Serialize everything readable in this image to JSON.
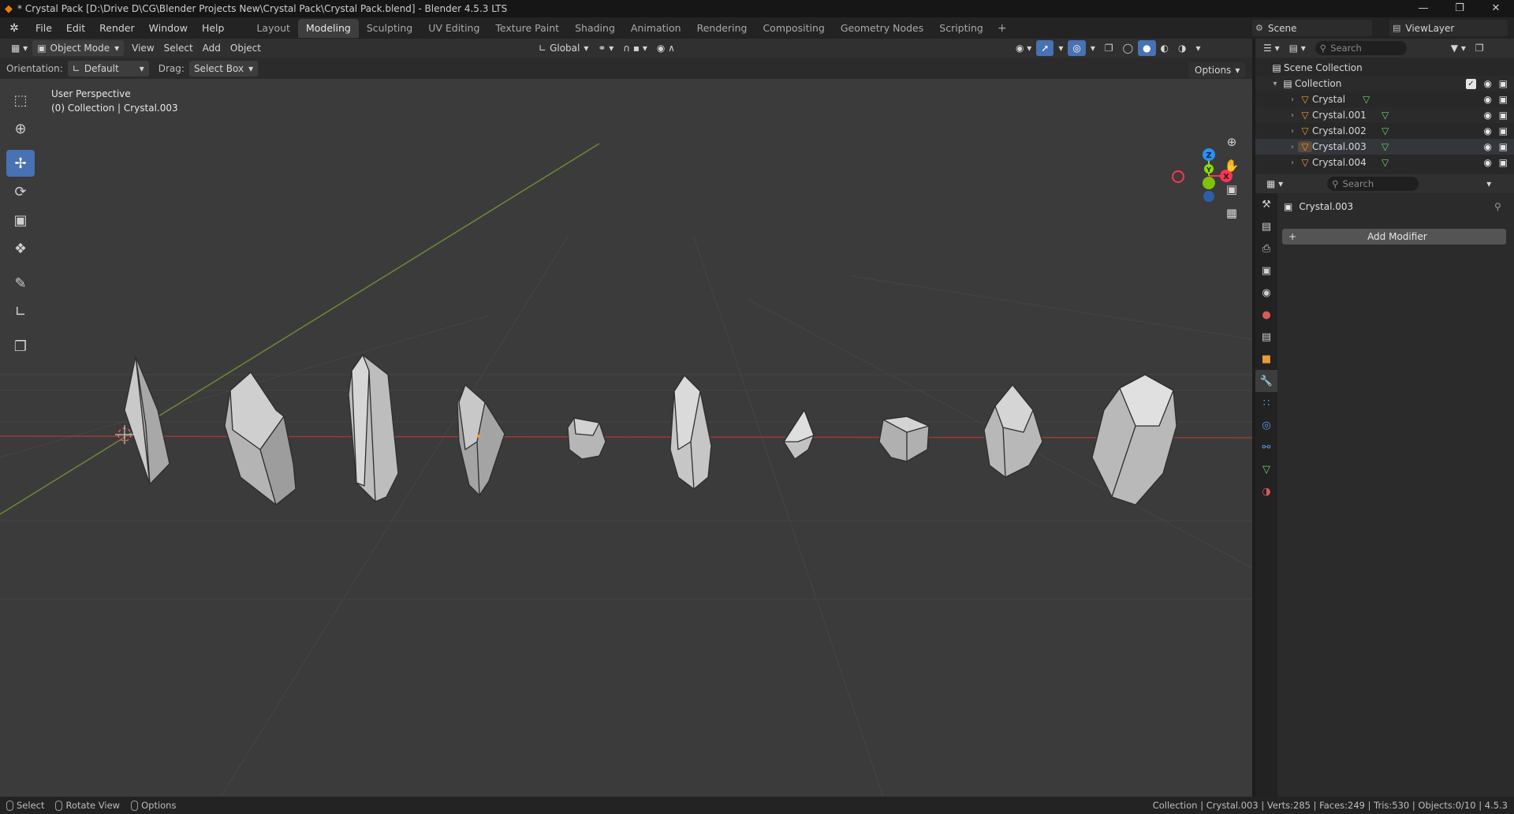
{
  "window": {
    "title": "* Crystal Pack [D:\\Drive D\\CG\\Blender Projects New\\Crystal Pack\\Crystal Pack.blend] - Blender 4.5.3 LTS",
    "controls": [
      "—",
      "❐",
      "✕"
    ]
  },
  "menu": {
    "items": [
      "File",
      "Edit",
      "Render",
      "Window",
      "Help"
    ]
  },
  "workspaces": {
    "tabs": [
      "Layout",
      "Modeling",
      "Sculpting",
      "UV Editing",
      "Texture Paint",
      "Shading",
      "Animation",
      "Rendering",
      "Compositing",
      "Geometry Nodes",
      "Scripting"
    ],
    "active": "Modeling",
    "add": "+"
  },
  "scene": {
    "label": "Scene"
  },
  "view_layer": {
    "label": "ViewLayer"
  },
  "viewport_header": {
    "mode": "Object Mode",
    "menus": [
      "View",
      "Select",
      "Add",
      "Object"
    ],
    "transform_orientation": "Global",
    "orientation_label": "Orientation:",
    "orientation_value": "Default",
    "drag_label": "Drag:",
    "drag_value": "Select Box",
    "options": "Options"
  },
  "viewport": {
    "perspective": "User Perspective",
    "collection_info": "(0) Collection | Crystal.003",
    "gizmo_axes": [
      "X",
      "Y",
      "Z"
    ]
  },
  "toolbar": {
    "tools": [
      "select-box",
      "cursor",
      "move",
      "rotate",
      "scale",
      "transform",
      "annotate",
      "measure",
      "add-cube"
    ],
    "active": "move"
  },
  "outliner": {
    "search_placeholder": "Search",
    "scene_collection": "Scene Collection",
    "collection": "Collection",
    "objects": [
      "Crystal",
      "Crystal.001",
      "Crystal.002",
      "Crystal.003",
      "Crystal.004"
    ],
    "selected": "Crystal.003"
  },
  "properties": {
    "search_placeholder": "Search",
    "object_name": "Crystal.003",
    "add_modifier": "Add Modifier",
    "active_tab": "modifiers"
  },
  "statusbar": {
    "hints": [
      "Select",
      "Rotate View",
      "Options"
    ],
    "stats": "Collection | Crystal.003 | Verts:285 | Faces:249 | Tris:530 | Objects:0/10 | 4.5.3"
  },
  "colors": {
    "accent": "#4772b3",
    "axis_x": "#ff3352",
    "axis_y": "#8bdc00",
    "axis_z": "#2890ff",
    "object_icon": "#e89a3c",
    "mesh_icon": "#6fd36f"
  }
}
